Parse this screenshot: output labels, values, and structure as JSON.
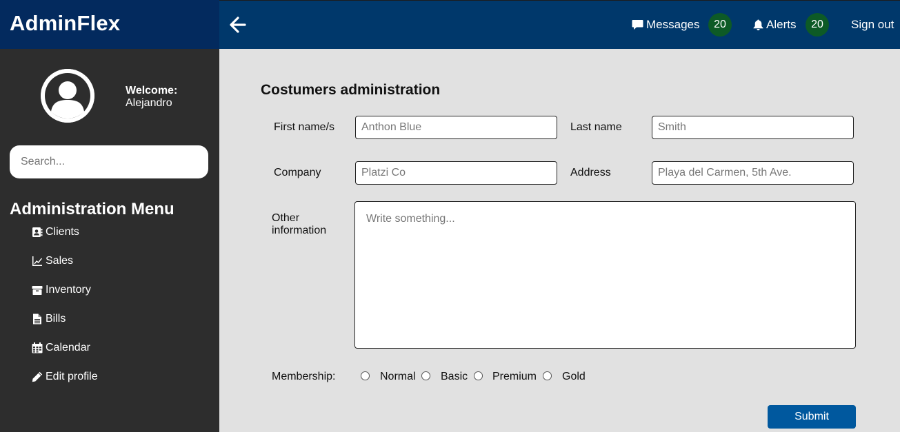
{
  "brand": {
    "title": "AdminFlex"
  },
  "user": {
    "welcome_label": "Welcome:",
    "name": "Alejandro"
  },
  "search": {
    "placeholder": "Search..."
  },
  "menu": {
    "title": "Administration Menu",
    "items": [
      {
        "label": "Clients",
        "icon": "address-book-icon"
      },
      {
        "label": "Sales",
        "icon": "line-chart-icon"
      },
      {
        "label": "Inventory",
        "icon": "archive-box-icon"
      },
      {
        "label": "Bills",
        "icon": "file-icon"
      },
      {
        "label": "Calendar",
        "icon": "calendar-icon"
      },
      {
        "label": "Edit profile",
        "icon": "pencil-icon"
      }
    ]
  },
  "header": {
    "messages_label": "Messages",
    "messages_count": "20",
    "alerts_label": "Alerts",
    "alerts_count": "20",
    "signout_label": "Sign out",
    "badge_color": "#0d5a26"
  },
  "form": {
    "title": "Costumers administration",
    "first_name_label": "First name/s",
    "first_name_placeholder": "Anthon Blue",
    "last_name_label": "Last name",
    "last_name_placeholder": "Smith",
    "company_label": "Company",
    "company_placeholder": "Platzi Co",
    "address_label": "Address",
    "address_placeholder": "Playa del Carmen, 5th Ave.",
    "other_label_line1": "Other",
    "other_label_line2": "information",
    "other_placeholder": "Write something...",
    "membership_label": "Membership:",
    "membership_options": [
      "Normal",
      "Basic",
      "Premium",
      "Gold"
    ],
    "submit_label": "Submit"
  },
  "colors": {
    "brand_bg": "#032a5e",
    "header_bg": "#00386b",
    "sidebar_bg": "#2d2d2d",
    "content_bg": "#e1e1e1",
    "submit_bg": "#00589e"
  }
}
